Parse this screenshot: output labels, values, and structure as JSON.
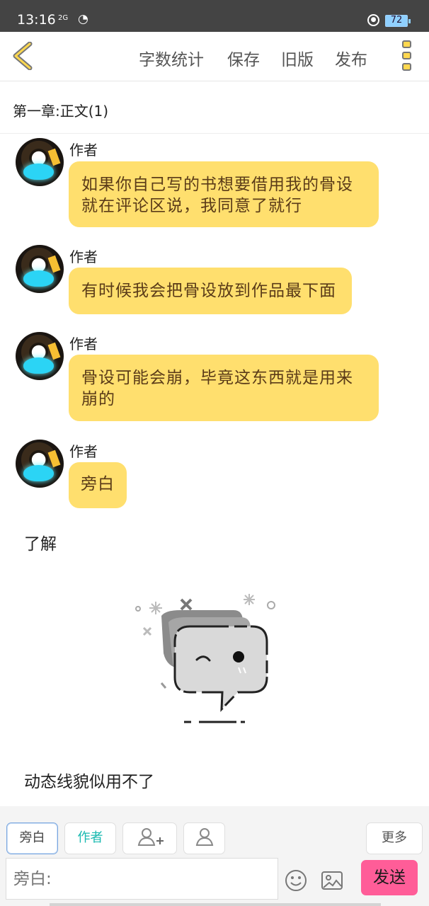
{
  "status": {
    "time": "13:16",
    "network": "2G",
    "battery": "72"
  },
  "toolbar": {
    "word_count": "字数统计",
    "save": "保存",
    "old_version": "旧版",
    "publish": "发布"
  },
  "chapter": {
    "title": "第一章:正文(1)"
  },
  "messages": [
    {
      "author": "作者",
      "text": "如果你自己写的书想要借用我的骨设就在评论区说，我同意了就行"
    },
    {
      "author": "作者",
      "text": "有时候我会把骨设放到作品最下面"
    },
    {
      "author": "作者",
      "text": "骨设可能会崩，毕竟这东西就是用来崩的"
    },
    {
      "author": "作者",
      "text": "旁白"
    }
  ],
  "plain_messages": [
    "了解",
    "动态线貌似用不了"
  ],
  "composer": {
    "narration_button": "旁白",
    "author_button": "作者",
    "more_button": "更多",
    "placeholder": "旁白:",
    "send": "发送"
  },
  "colors": {
    "bubble": "#ffdf6e",
    "send": "#ff5d98",
    "author_chip": "#18b9b0",
    "status_bar": "#444444"
  }
}
